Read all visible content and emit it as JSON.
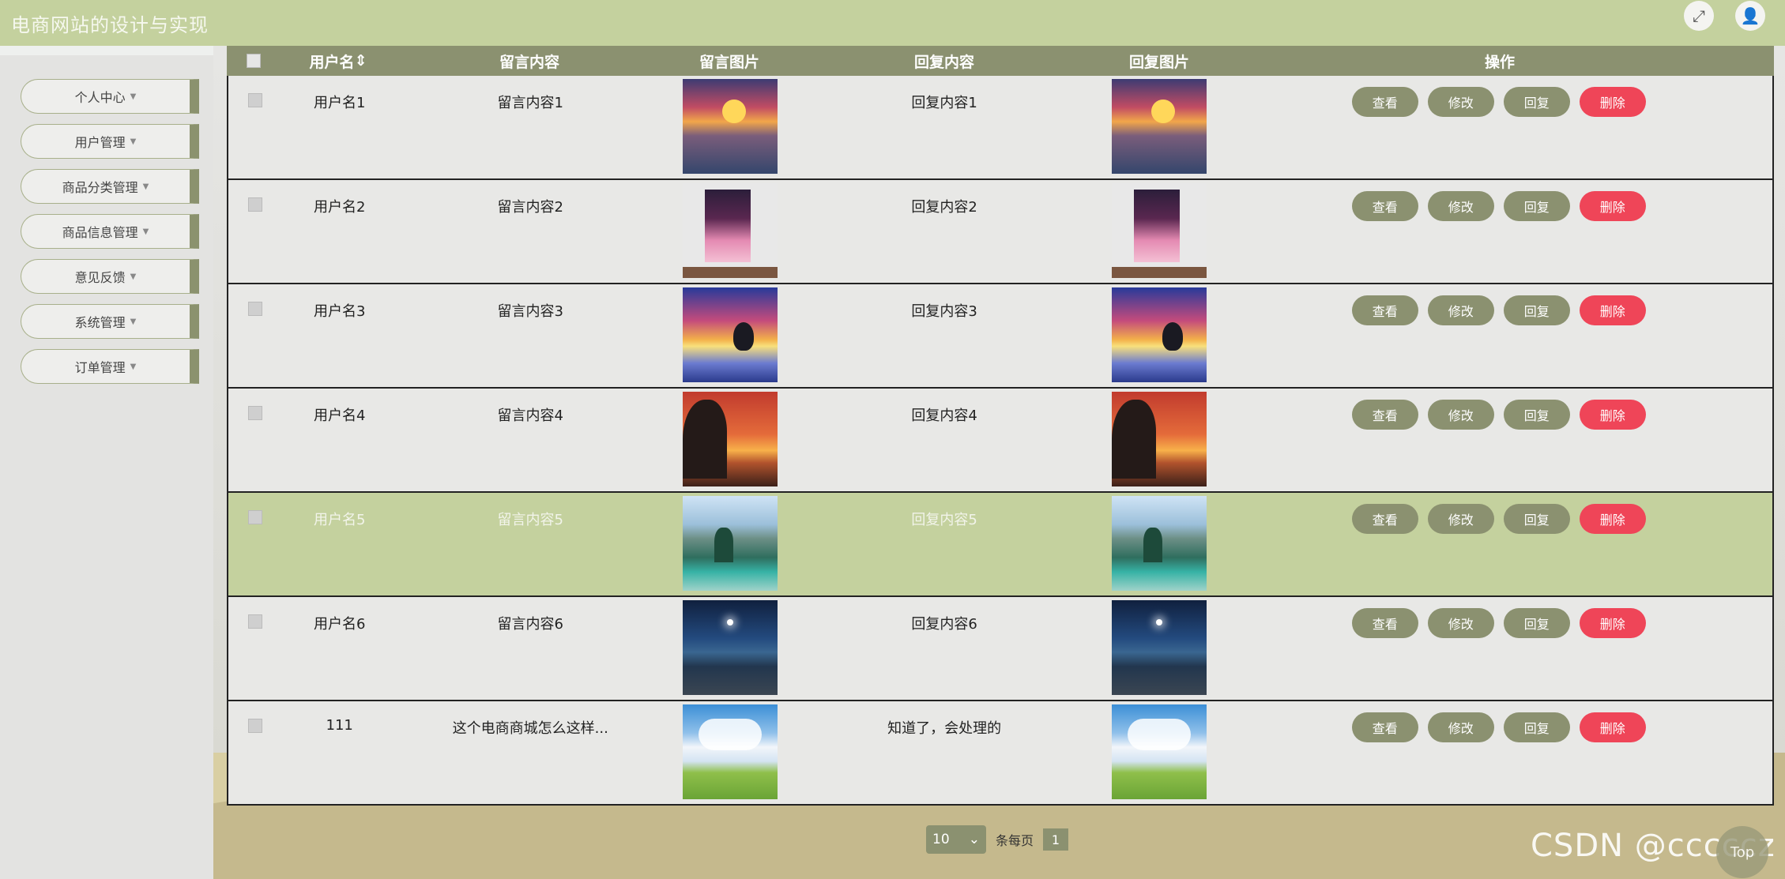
{
  "header": {
    "title": "电商网站的设计与实现",
    "fullscreen_icon": "expand-icon",
    "user_icon": "user-icon"
  },
  "sidebar": {
    "items": [
      {
        "label": "个人中心"
      },
      {
        "label": "用户管理"
      },
      {
        "label": "商品分类管理"
      },
      {
        "label": "商品信息管理"
      },
      {
        "label": "意见反馈"
      },
      {
        "label": "系统管理"
      },
      {
        "label": "订单管理"
      }
    ]
  },
  "table": {
    "headers": {
      "user": "用户名",
      "message": "留言内容",
      "message_image": "留言图片",
      "reply": "回复内容",
      "reply_image": "回复图片",
      "actions": "操作"
    },
    "rows": [
      {
        "user": "用户名1",
        "message": "留言内容1",
        "reply": "回复内容1",
        "image": "sunset-harbor"
      },
      {
        "user": "用户名2",
        "message": "留言内容2",
        "reply": "回复内容2",
        "image": "pink-clouds-poster"
      },
      {
        "user": "用户名3",
        "message": "留言内容3",
        "reply": "回复内容3",
        "image": "dolphin-sunset"
      },
      {
        "user": "用户名4",
        "message": "留言内容4",
        "reply": "回复内容4",
        "image": "tree-sunset"
      },
      {
        "user": "用户名5",
        "message": "留言内容5",
        "reply": "回复内容5",
        "image": "mountain-lake"
      },
      {
        "user": "用户名6",
        "message": "留言内容6",
        "reply": "回复内容6",
        "image": "night-landscape"
      },
      {
        "user": "111",
        "message": "这个电商商城怎么这样...",
        "reply": "知道了，会处理的",
        "image": "green-meadow"
      }
    ],
    "actions": {
      "view": "查看",
      "edit": "修改",
      "reply": "回复",
      "delete": "删除"
    }
  },
  "pagination": {
    "page_size": "10",
    "page_size_label": "条每页",
    "current_page": "1"
  },
  "watermark": "CSDN @cccccz",
  "top_button": "Top",
  "colors": {
    "header_bg": "#c4d19e",
    "accent": "#8b9170",
    "danger": "#ef4558",
    "highlight_row": "#c4d19e"
  }
}
